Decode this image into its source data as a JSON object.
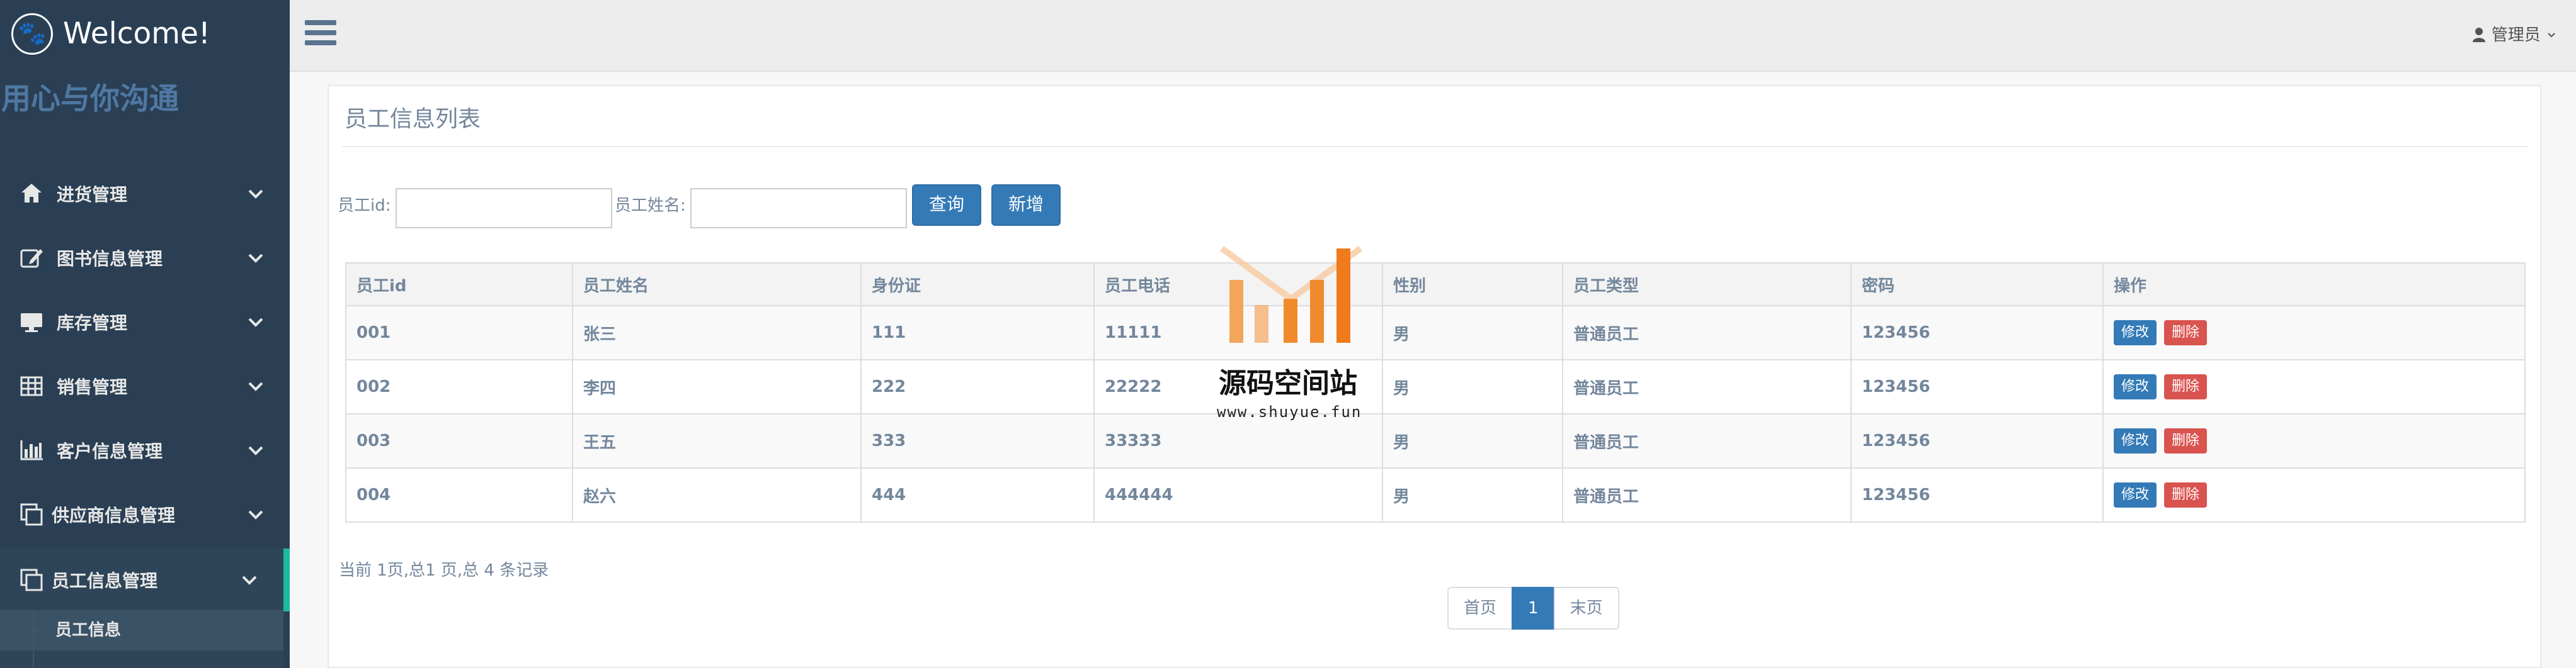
{
  "brand": {
    "title": "Welcome!",
    "icon": "paw-icon"
  },
  "slogan": "用心与你沟通",
  "sidebar": {
    "items": [
      {
        "label": "进货管理",
        "icon": "home-icon"
      },
      {
        "label": "图书信息管理",
        "icon": "edit-icon"
      },
      {
        "label": "库存管理",
        "icon": "desktop-icon"
      },
      {
        "label": "销售管理",
        "icon": "table-icon"
      },
      {
        "label": "客户信息管理",
        "icon": "bar-chart-icon"
      },
      {
        "label": "供应商信息管理",
        "icon": "clone-icon"
      },
      {
        "label": "员工信息管理",
        "icon": "clone-icon"
      }
    ],
    "sub_item": "员工信息"
  },
  "topnav": {
    "user": "管理员"
  },
  "panel": {
    "title": "员工信息列表"
  },
  "search": {
    "id_label": "员工id:",
    "id_value": "",
    "name_label": "员工姓名:",
    "name_value": "",
    "query_button": "查询",
    "add_button": "新增"
  },
  "table": {
    "headers": [
      "员工id",
      "员工姓名",
      "身份证",
      "员工电话",
      "性别",
      "员工类型",
      "密码",
      "操作"
    ],
    "rows": [
      [
        "001",
        "张三",
        "111",
        "11111",
        "男",
        "普通员工",
        "123456"
      ],
      [
        "002",
        "李四",
        "222",
        "22222",
        "男",
        "普通员工",
        "123456"
      ],
      [
        "003",
        "王五",
        "333",
        "33333",
        "男",
        "普通员工",
        "123456"
      ],
      [
        "004",
        "赵六",
        "444",
        "444444",
        "男",
        "普通员工",
        "123456"
      ]
    ],
    "edit_label": "修改",
    "delete_label": "删除"
  },
  "summary": "当前 1页,总1 页,总 4 条记录",
  "pagination": {
    "first": "首页",
    "current": "1",
    "last": "末页"
  },
  "watermark": {
    "text": "源码空间站",
    "url": "www.shuyue.fun"
  },
  "colors": {
    "sidebar": "#2a3f54",
    "primary": "#337ab7",
    "danger": "#d9534f",
    "accent": "#1abb9c"
  }
}
